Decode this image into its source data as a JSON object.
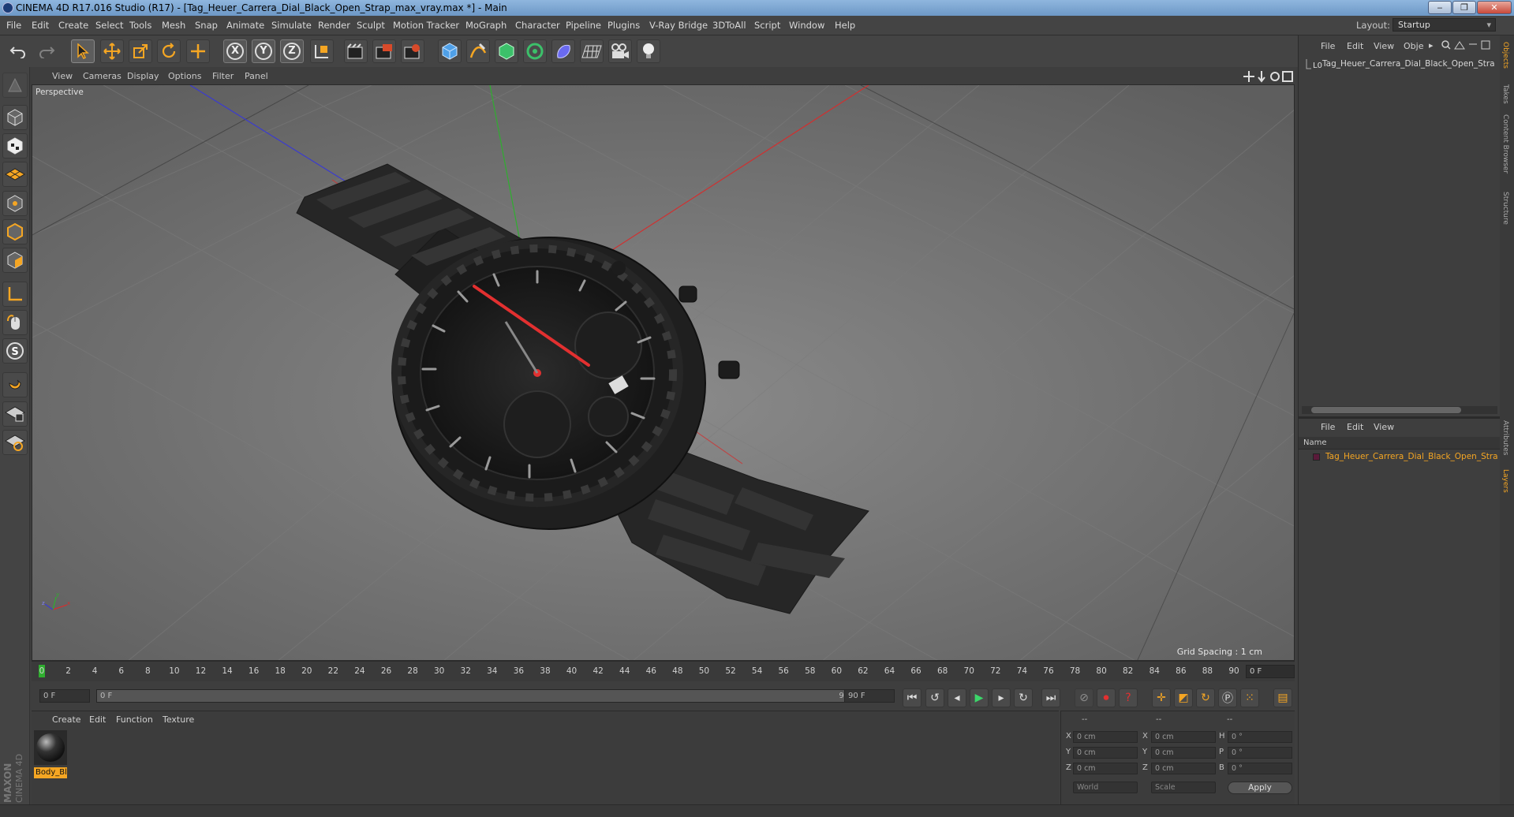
{
  "window": {
    "title": "CINEMA 4D R17.016 Studio (R17) - [Tag_Heuer_Carrera_Dial_Black_Open_Strap_max_vray.max *] - Main",
    "controls": [
      "‒",
      "❐",
      "✕"
    ]
  },
  "menu": {
    "items": [
      "File",
      "Edit",
      "Create",
      "Select",
      "Tools",
      "Mesh",
      "Snap",
      "Animate",
      "Simulate",
      "Render",
      "Sculpt",
      "Motion Tracker",
      "MoGraph",
      "Character",
      "Pipeline",
      "Plugins",
      "V-Ray Bridge",
      "3DToAll",
      "Script",
      "Window",
      "Help"
    ],
    "layout_label": "Layout:",
    "layout_value": "Startup"
  },
  "toolbar": {
    "axis_x": "X",
    "axis_y": "Y",
    "axis_z": "Z",
    "icons": [
      "undo-icon",
      "redo-icon",
      "select-arrow-icon",
      "move-icon",
      "scale-icon",
      "rotate-icon",
      "live-select-icon",
      "x-axis-icon",
      "y-axis-icon",
      "z-axis-icon",
      "coordinate-system-icon",
      "render-view-icon",
      "render-picture-viewer-icon",
      "edit-render-settings-icon",
      "cube-primitive-icon",
      "spline-pen-icon",
      "nurbs-icon",
      "mograph-cloner-icon",
      "deformer-icon",
      "floor-grid-icon",
      "camera-icon",
      "light-bulb-icon"
    ]
  },
  "left_tools": [
    "make-editable-icon",
    "model-mode-icon",
    "texture-mode-icon",
    "workplane-icon",
    "points-mode-icon",
    "edges-mode-icon",
    "polygons-mode-icon",
    "axis-mode-icon",
    "tweak-mode-icon",
    "snap-s-icon",
    "magnet-icon",
    "lock-workplane-icon",
    "quantize-icon"
  ],
  "viewport": {
    "menu": [
      "View",
      "Cameras",
      "Display",
      "Options",
      "Filter",
      "Panel"
    ],
    "label": "Perspective",
    "grid_spacing": "Grid Spacing : 1 cm"
  },
  "timeline": {
    "ticks": [
      "0",
      "2",
      "4",
      "6",
      "8",
      "10",
      "12",
      "14",
      "16",
      "18",
      "20",
      "22",
      "24",
      "26",
      "28",
      "30",
      "32",
      "34",
      "36",
      "38",
      "40",
      "42",
      "44",
      "46",
      "48",
      "50",
      "52",
      "54",
      "56",
      "58",
      "60",
      "62",
      "64",
      "66",
      "68",
      "70",
      "72",
      "74",
      "76",
      "78",
      "80",
      "82",
      "84",
      "86",
      "88",
      "90"
    ],
    "current_frame": "0 F"
  },
  "playback": {
    "start_field": "0 F",
    "range_start": "0 F",
    "range_end": "90 F",
    "end_field": "90 F"
  },
  "material_manager": {
    "menu": [
      "Create",
      "Edit",
      "Function",
      "Texture"
    ],
    "material_name": "Body_Bl"
  },
  "coordinates": {
    "header_dashes": [
      "--",
      "--",
      "--"
    ],
    "rows": [
      {
        "a": "X",
        "av": "0 cm",
        "b": "X",
        "bv": "0 cm",
        "c": "H",
        "cv": "0 °"
      },
      {
        "a": "Y",
        "av": "0 cm",
        "b": "Y",
        "bv": "0 cm",
        "c": "P",
        "cv": "0 °"
      },
      {
        "a": "Z",
        "av": "0 cm",
        "b": "Z",
        "bv": "0 cm",
        "c": "B",
        "cv": "0 °"
      }
    ],
    "world": "World",
    "scale": "Scale",
    "apply": "Apply"
  },
  "object_manager": {
    "menu": [
      "File",
      "Edit",
      "View",
      "Obje"
    ],
    "object_name": "Tag_Heuer_Carrera_Dial_Black_Open_Stra"
  },
  "layer_manager": {
    "menu": [
      "File",
      "Edit",
      "View"
    ],
    "column_name": "Name",
    "layer_name": "Tag_Heuer_Carrera_Dial_Black_Open_Stra"
  },
  "side_tabs": [
    "Objects",
    "Takes",
    "Content Browser",
    "Structure",
    "Attributes",
    "Layers"
  ],
  "branding": "MAXON CINEMA 4D",
  "colors": {
    "accent_orange": "#f5a623",
    "axis_red": "#d03030",
    "axis_green": "#2fae2f",
    "axis_blue": "#3a3ad0"
  }
}
